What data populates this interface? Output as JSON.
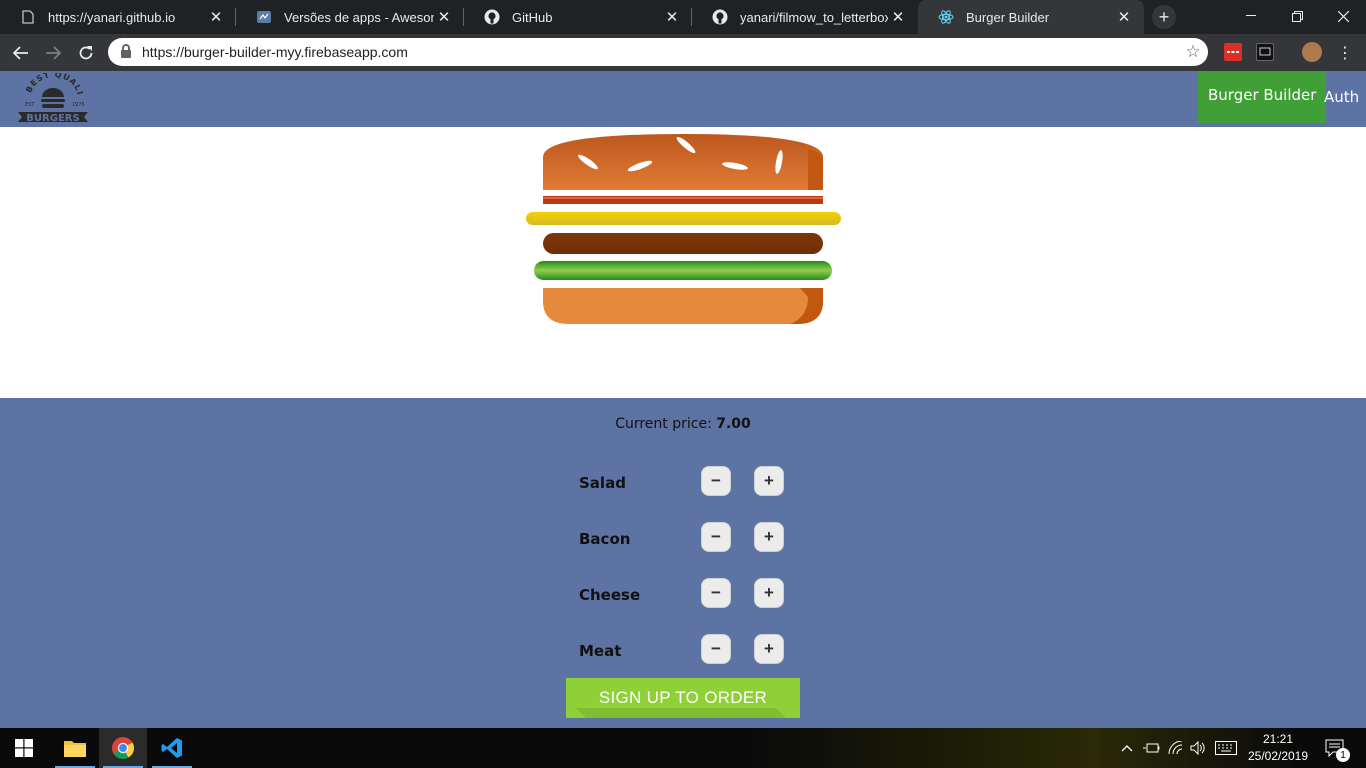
{
  "browser": {
    "tabs": [
      {
        "title": "https://yanari.github.io",
        "icon": "page-icon"
      },
      {
        "title": "Versões de apps - AwesomeLis",
        "icon": "awesomelist-icon"
      },
      {
        "title": "GitHub",
        "icon": "github-icon"
      },
      {
        "title": "yanari/filmow_to_letterboxd: Im",
        "icon": "github-icon"
      },
      {
        "title": "Burger Builder",
        "icon": "react-icon",
        "active": true
      }
    ],
    "url": "https://burger-builder-myy.firebaseapp.com"
  },
  "app": {
    "logo": {
      "top_text": "BEST QUALITY",
      "est": "EST",
      "year": "1975",
      "bottom_text": "BURGERS"
    },
    "nav": [
      {
        "label": "Burger Builder",
        "active": true
      },
      {
        "label": "Auth",
        "active": false
      }
    ],
    "price_label": "Current price: ",
    "price_value": "7.00",
    "ingredients": [
      {
        "label": "Salad",
        "less": "−",
        "more": "+"
      },
      {
        "label": "Bacon",
        "less": "−",
        "more": "+"
      },
      {
        "label": "Cheese",
        "less": "−",
        "more": "+"
      },
      {
        "label": "Meat",
        "less": "−",
        "more": "+"
      }
    ],
    "order_button": "SIGN UP TO ORDER",
    "colors": {
      "nav_bg": "#5c73a3",
      "active_nav": "#40a037",
      "order_button": "#8fd038"
    }
  },
  "taskbar": {
    "time": "21:21",
    "date": "25/02/2019",
    "notification_count": "1"
  }
}
